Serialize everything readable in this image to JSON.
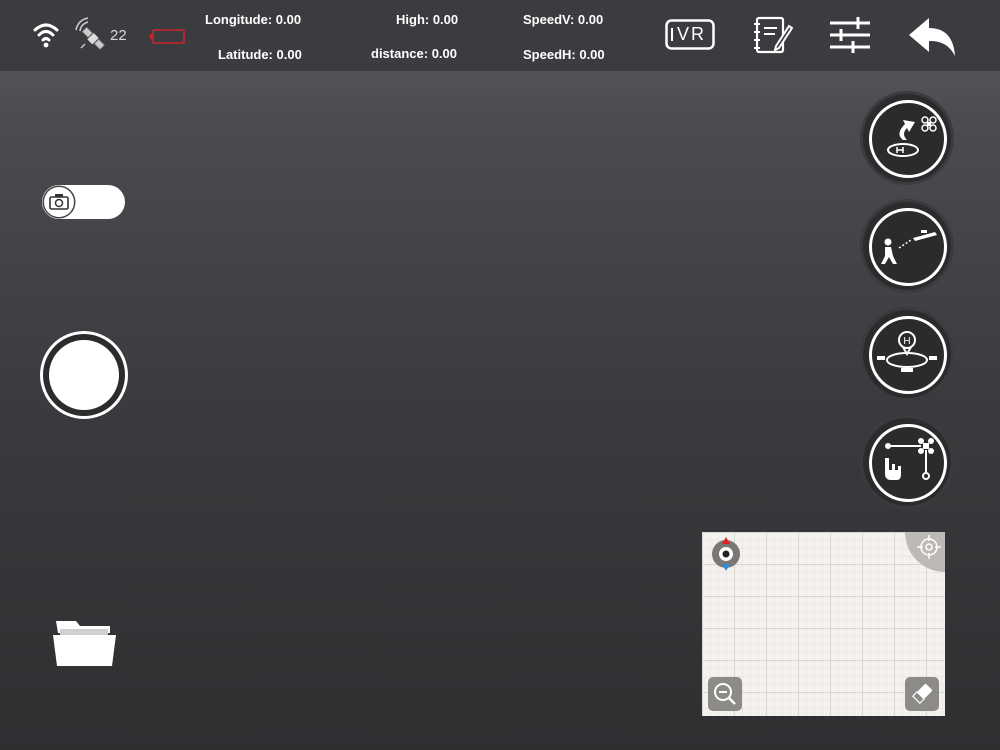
{
  "status": {
    "satellites": "22",
    "battery_color": "#d0222a"
  },
  "telemetry": {
    "longitude": {
      "label": "Longitude:",
      "value": "0.00"
    },
    "latitude": {
      "label": "Latitude:",
      "value": "0.00"
    },
    "high": {
      "label": "High:",
      "value": "0.00"
    },
    "distance": {
      "label": "distance:",
      "value": "0.00"
    },
    "speedv": {
      "label": "SpeedV:",
      "value": "0.00"
    },
    "speedh": {
      "label": "SpeedH:",
      "value": "0.00"
    }
  },
  "toolbar": {
    "vr_label": "VR",
    "icons": [
      "vr-mode-icon",
      "flight-log-icon",
      "settings-sliders-icon",
      "back-arrow-icon"
    ]
  },
  "right_controls": [
    "return-home-icon",
    "follow-me-icon",
    "orbit-point-icon",
    "waypoint-flight-icon"
  ],
  "left_controls": [
    "camera-video-toggle",
    "shutter-button",
    "media-folder-icon"
  ],
  "map": {
    "buttons": [
      "compass-icon",
      "locate-icon",
      "zoom-out-icon",
      "eraser-icon"
    ],
    "compass_north_color": "#e02020",
    "compass_south_color": "#2a8ee0"
  }
}
